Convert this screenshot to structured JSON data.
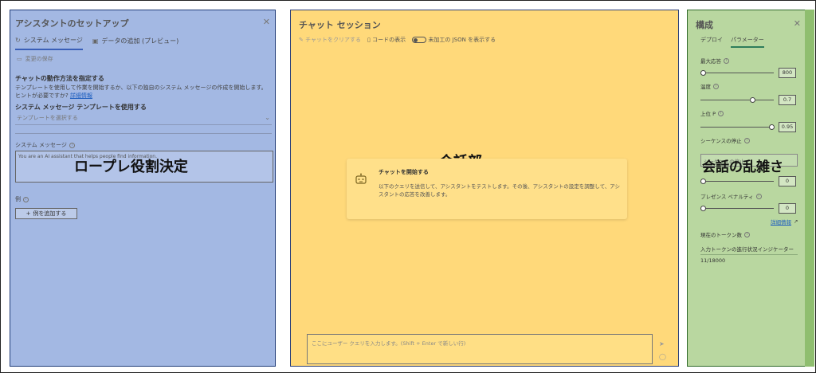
{
  "left": {
    "title": "アシスタントのセットアップ",
    "close": "✕",
    "tabs": [
      {
        "label": "システム メッセージ"
      },
      {
        "label": "データの追加 (プレビュー)"
      }
    ],
    "save_label": "変更の保存",
    "heading": "チャットの動作方法を指定する",
    "description": "テンプレートを使用して作業を開始するか、以下の独自のシステム メッセージの作成を開始します。ヒントが必要ですか?",
    "learn_more": "詳細情報",
    "template_heading": "システム メッセージ テンプレートを使用する",
    "template_placeholder": "テンプレートを選択する",
    "system_message_label": "システム メッセージ",
    "system_message_value": "You are an AI assistant that helps people find information.",
    "examples_label": "例",
    "add_example": "例を追加する",
    "overlay": "ロープレ役割決定"
  },
  "middle": {
    "title": "チャット セッション",
    "tools": {
      "clear": "チャットをクリアする",
      "show_code": "コードの表示",
      "show_json": "未加工の JSON を表示する"
    },
    "overlay": "会話部",
    "card": {
      "title": "チャットを開始する",
      "description": "以下のクエリを送信して、アシスタントをテストします。その後、アシスタントの設定を調整して、アシスタントの応答を改善します。"
    },
    "input_placeholder": "ここにユーザー クエリを入力します。(Shift + Enter で新しい行)"
  },
  "right": {
    "title": "構成",
    "close": "✕",
    "tabs": [
      {
        "label": "デプロイ"
      },
      {
        "label": "パラメーター"
      }
    ],
    "params": {
      "max_response": {
        "label": "最大応答",
        "value": "800"
      },
      "temperature": {
        "label": "温度",
        "value": "0.7"
      },
      "top_p": {
        "label": "上位 P",
        "value": "0.95"
      },
      "stop_sequence": {
        "label": "シーケンスの停止",
        "placeholder": "シーケンスの停止"
      },
      "frequency_penalty": {
        "value": "0"
      },
      "presence_penalty": {
        "label": "プレゼンス ペナルティ",
        "value": "0"
      }
    },
    "learn_more": "詳細情報",
    "token_label": "現在のトークン数",
    "token_indicator": "入力トークンの進行状況インジケーター",
    "token_count": "11/18000",
    "overlay": "会話の乱雑さ"
  }
}
